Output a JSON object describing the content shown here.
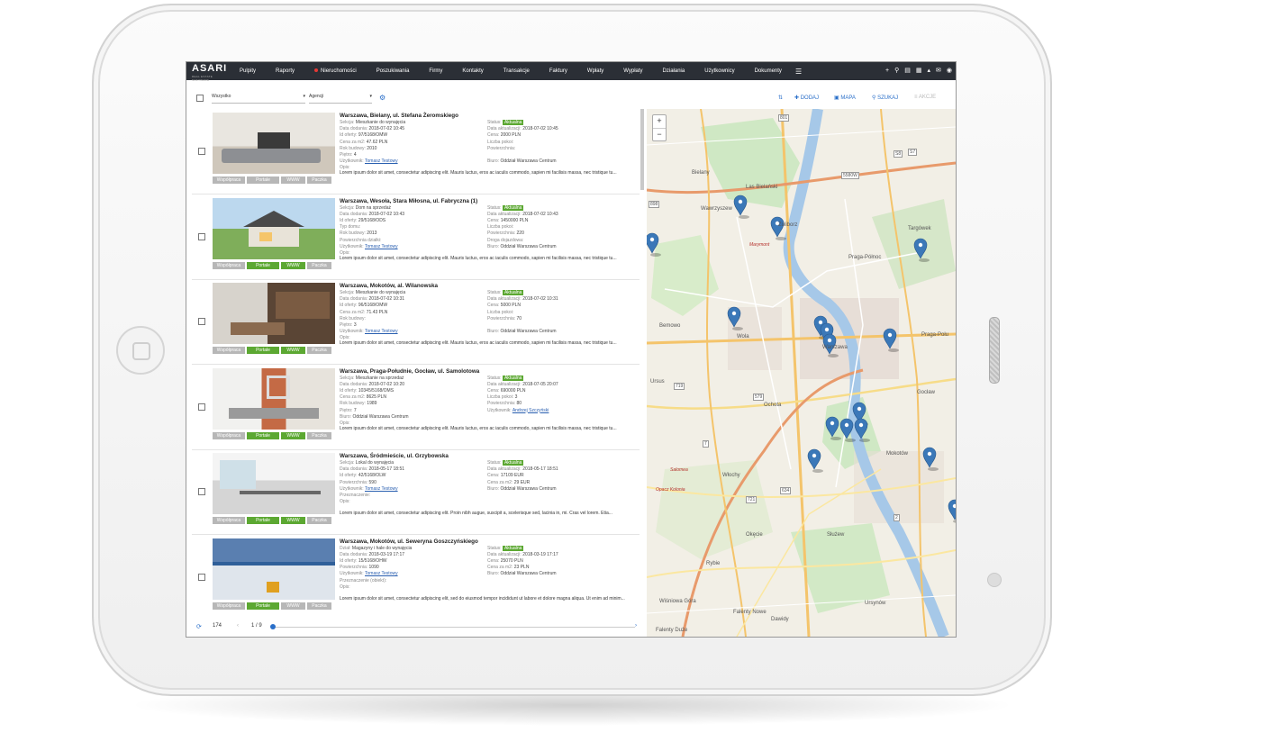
{
  "nav": {
    "logo": "ASARI",
    "logo_sub": "REAL ESTATE SOFTWARE",
    "items": [
      "Pulpity",
      "Raporty",
      "Nieruchomości",
      "Poszukiwania",
      "Firmy",
      "Kontakty",
      "Transakcje",
      "Faktury",
      "Wpłaty",
      "Wypłaty",
      "Działania",
      "Użytkownicy",
      "Dokumenty"
    ],
    "active_item": "Nieruchomości",
    "menu_icon": "hamburger-icon",
    "right_icons": [
      "plus-icon",
      "search-icon",
      "cart-icon",
      "calendar-icon",
      "bell-icon",
      "mail-icon",
      "user-icon"
    ]
  },
  "toolbar": {
    "filter1": "Wszystko",
    "filter2": "Agencji",
    "add": "DODAJ",
    "map": "MAPA",
    "search": "SZUKAJ",
    "actions": "AKCJE"
  },
  "listings": [
    {
      "title": "Warszawa, Bielany, ul. Stefana Żeromskiego",
      "left": [
        [
          "Sekcja:",
          "Mieszkanie do wynajęcia"
        ],
        [
          "Data dodania:",
          "2018-07-02 10:45"
        ],
        [
          "Id oferty:",
          "97/5168/OMW"
        ],
        [
          "Cena za m2:",
          "47.62 PLN"
        ],
        [
          "Rok budowy:",
          "2010"
        ],
        [
          "Piętro:",
          "4"
        ],
        [
          "Użytkownik:",
          "Tomasz Testowy"
        ],
        [
          "Opis:",
          ""
        ]
      ],
      "right": [
        [
          "Status:",
          "Aktualna"
        ],
        [
          "Data aktualizacji:",
          "2018-07-02 10:45"
        ],
        [
          "Cena:",
          "2000 PLN"
        ],
        [
          "Liczba pokoi:",
          ""
        ],
        [
          "Powierzchnia:",
          ""
        ],
        [
          "",
          ""
        ],
        [
          "Biuro:",
          "Oddział Warszawa Centrum"
        ]
      ],
      "description": "Lorem ipsum dolor sit amet, consectetur adipiscing elit. Mauris luctus, eros ac iaculis commodo, sapien mi facilisis massa, nec tristique tu...",
      "tags": [
        [
          "Współpraca",
          false
        ],
        [
          "Portale",
          false
        ],
        [
          "WWW",
          false
        ],
        [
          "Paczka",
          false
        ]
      ]
    },
    {
      "title": "Warszawa, Wesoła, Stara Miłosna, ul. Fabryczna (1)",
      "left": [
        [
          "Sekcja:",
          "Dom na sprzedaż"
        ],
        [
          "Data dodania:",
          "2018-07-02 10:43"
        ],
        [
          "Id oferty:",
          "29/5168/ODS"
        ],
        [
          "Typ domu:",
          ""
        ],
        [
          "Rok budowy:",
          "2013"
        ],
        [
          "Powierzchnia działki:",
          ""
        ],
        [
          "Użytkownik:",
          "Tomasz Testowy"
        ],
        [
          "Opis:",
          ""
        ]
      ],
      "right": [
        [
          "Status:",
          "Aktualna"
        ],
        [
          "Data aktualizacji:",
          "2018-07-02 10:43"
        ],
        [
          "Cena:",
          "1450000 PLN"
        ],
        [
          "Liczba pokoi:",
          ""
        ],
        [
          "Powierzchnia:",
          "220"
        ],
        [
          "Droga dojazdowa:",
          ""
        ],
        [
          "Biuro:",
          "Oddział Warszawa Centrum"
        ]
      ],
      "description": "Lorem ipsum dolor sit amet, consectetur adipiscing elit. Mauris luctus, eros ac iaculis commodo, sapien mi facilisis massa, nec tristique tu...",
      "tags": [
        [
          "Współpraca",
          false
        ],
        [
          "Portale",
          true
        ],
        [
          "WWW",
          true
        ],
        [
          "Paczka",
          false
        ]
      ]
    },
    {
      "title": "Warszawa, Mokotów, al. Wilanowska",
      "left": [
        [
          "Sekcja:",
          "Mieszkanie do wynajęcia"
        ],
        [
          "Data dodania:",
          "2018-07-02 10:31"
        ],
        [
          "Id oferty:",
          "96/5168/OMW"
        ],
        [
          "Cena za m2:",
          "71.43 PLN"
        ],
        [
          "Rok budowy:",
          ""
        ],
        [
          "Piętro:",
          "3"
        ],
        [
          "Użytkownik:",
          "Tomasz Testowy"
        ],
        [
          "Opis:",
          ""
        ]
      ],
      "right": [
        [
          "Status:",
          "Aktualna"
        ],
        [
          "Data aktualizacji:",
          "2018-07-02 10:31"
        ],
        [
          "Cena:",
          "5000 PLN"
        ],
        [
          "Liczba pokoi:",
          ""
        ],
        [
          "Powierzchnia:",
          "70"
        ],
        [
          "",
          ""
        ],
        [
          "Biuro:",
          "Oddział Warszawa Centrum"
        ]
      ],
      "description": "Lorem ipsum dolor sit amet, consectetur adipiscing elit. Mauris luctus, eros ac iaculis commodo, sapien mi facilisis massa, nec tristique tu...",
      "tags": [
        [
          "Współpraca",
          false
        ],
        [
          "Portale",
          true
        ],
        [
          "WWW",
          true
        ],
        [
          "Paczka",
          false
        ]
      ]
    },
    {
      "title": "Warszawa, Praga-Południe, Gocław, ul. Samolotowa",
      "left": [
        [
          "Sekcja:",
          "Mieszkanie na sprzedaż"
        ],
        [
          "Data dodania:",
          "2018-07-02 10:20"
        ],
        [
          "Id oferty:",
          "10345/5168/OMS"
        ],
        [
          "Cena za m2:",
          "8625 PLN"
        ],
        [
          "Rok budowy:",
          "1989"
        ],
        [
          "Piętro:",
          "7"
        ],
        [
          "Biuro:",
          "Oddział Warszawa Centrum"
        ],
        [
          "Opis:",
          ""
        ]
      ],
      "right": [
        [
          "Status:",
          "Aktualna"
        ],
        [
          "Data aktualizacji:",
          "2018-07-05 20:07"
        ],
        [
          "Cena:",
          "690000 PLN"
        ],
        [
          "Liczba pokoi:",
          "3"
        ],
        [
          "Powierzchnia:",
          "80"
        ],
        [
          "Użytkownik:",
          "Andrzej Szczyński"
        ]
      ],
      "description": "Lorem ipsum dolor sit amet, consectetur adipiscing elit. Mauris luctus, eros ac iaculis commodo, sapien mi facilisis massa, nec tristique tu...",
      "tags": [
        [
          "Współpraca",
          false
        ],
        [
          "Portale",
          true
        ],
        [
          "WWW",
          true
        ],
        [
          "Paczka",
          false
        ]
      ]
    },
    {
      "title": "Warszawa, Śródmieście, ul. Grzybowska",
      "left": [
        [
          "Sekcja:",
          "Lokal do wynajęcia"
        ],
        [
          "Data dodania:",
          "2018-05-17 18:51"
        ],
        [
          "Id oferty:",
          "42/5168/OLW"
        ],
        [
          "Powierzchnia:",
          "590"
        ],
        [
          "Użytkownik:",
          "Tomasz Testowy"
        ],
        [
          "Przeznaczenie:",
          ""
        ],
        [
          "Opis:",
          ""
        ]
      ],
      "right": [
        [
          "Status:",
          "Aktualna"
        ],
        [
          "Data aktualizacji:",
          "2018-05-17 18:51"
        ],
        [
          "Cena:",
          "17109 EUR"
        ],
        [
          "Cena za m2:",
          "29 EUR"
        ],
        [
          "Biuro:",
          "Oddział Warszawa Centrum"
        ]
      ],
      "description": "Lorem ipsum dolor sit amet, consectetur adipiscing elit. Proin nibh augue, suscipit a, scelerisque sed, lacinia in, mi. Cras vel lorem. Etia...",
      "tags": [
        [
          "Współpraca",
          false
        ],
        [
          "Portale",
          true
        ],
        [
          "WWW",
          true
        ],
        [
          "Paczka",
          false
        ]
      ]
    },
    {
      "title": "Warszawa, Mokotów, ul. Seweryna Goszczyńskiego",
      "left": [
        [
          "Dział:",
          "Magazyny i hale do wynajęcia"
        ],
        [
          "Data dodania:",
          "2018-03-19 17:17"
        ],
        [
          "Id oferty:",
          "15/5168/OHW"
        ],
        [
          "Powierzchnia:",
          "1090"
        ],
        [
          "Użytkownik:",
          "Tomasz Testowy"
        ],
        [
          "Przeznaczenie (obiekt):",
          ""
        ],
        [
          "Opis:",
          ""
        ]
      ],
      "right": [
        [
          "Status:",
          "Aktualna"
        ],
        [
          "Data aktualizacji:",
          "2018-03-19 17:17"
        ],
        [
          "Cena:",
          "25070 PLN"
        ],
        [
          "Cena za m2:",
          "23 PLN"
        ],
        [
          "Biuro:",
          "Oddział Warszawa Centrum"
        ]
      ],
      "description": "Lorem ipsum dolor sit amet, consectetur adipiscing elit, sed do eiusmod tempor incididunt ut labore et dolore magna aliqua. Ut enim ad minim...",
      "tags": [
        [
          "Współpraca",
          false
        ],
        [
          "Portale",
          true
        ],
        [
          "WWW",
          false
        ],
        [
          "Paczka",
          false
        ]
      ]
    }
  ],
  "pager": {
    "count": "174",
    "pages": "1 / 9"
  },
  "map": {
    "zoom_in": "+",
    "zoom_out": "−",
    "labels": [
      "Bielany",
      "Żoliborz",
      "Targówek",
      "Praga-Północ",
      "Bemowo",
      "Wola",
      "Warszawa",
      "Praga-Połu",
      "Ochota",
      "Mokotów",
      "Włochy",
      "Ursynów",
      "Rybie",
      "Falenty Nowe",
      "Dawidy",
      "Falenty Duże",
      "Salomea",
      "Opacz Kolonia",
      "Wiśniowa Góra",
      "Marymont",
      "Las Bielański",
      "Wawrzyszew",
      "Ursus",
      "Okęcie",
      "Służew",
      "Gocław"
    ],
    "road_labels": [
      "801",
      "898",
      "5580W",
      "S8",
      "S7",
      "579",
      "634",
      "719",
      "721",
      "2",
      "7"
    ]
  },
  "colors": {
    "nav_bg": "#2b2f36",
    "accent": "#2a6fc9",
    "green": "#5ca832",
    "map_pin": "#3b78b8"
  }
}
